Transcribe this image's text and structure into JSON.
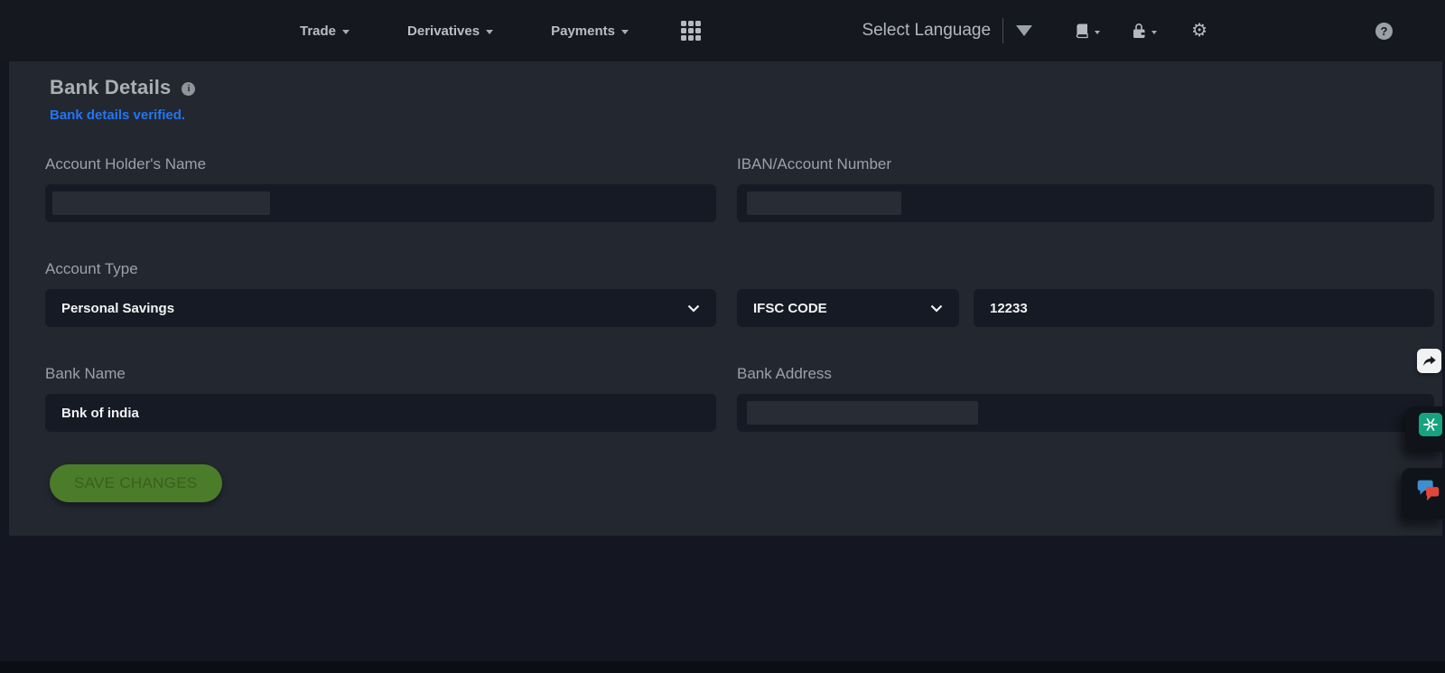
{
  "navbar": {
    "menus": [
      {
        "label": "Trade"
      },
      {
        "label": "Derivatives"
      },
      {
        "label": "Payments"
      }
    ],
    "language_label": "Select Language",
    "help_glyph": "?"
  },
  "content": {
    "title": "Bank Details",
    "info_glyph": "i",
    "verified_message": "Bank details verified.",
    "fields": {
      "account_holder_label": "Account Holder's Name",
      "iban_label": "IBAN/Account Number",
      "account_type_label": "Account Type",
      "account_type_value": "Personal Savings",
      "ifsc_select_value": "IFSC CODE",
      "ifsc_code_value": "12233",
      "bank_name_label": "Bank Name",
      "bank_name_value": "Bnk of india",
      "bank_address_label": "Bank Address"
    },
    "save_button_label": "SAVE CHANGES"
  },
  "colors": {
    "accent_blue": "#2175f5",
    "button_green": "#4b7c2a",
    "chatgpt_green": "#16a37f",
    "bubble_blue": "#3d8fd1",
    "bubble_red": "#e0473c"
  }
}
